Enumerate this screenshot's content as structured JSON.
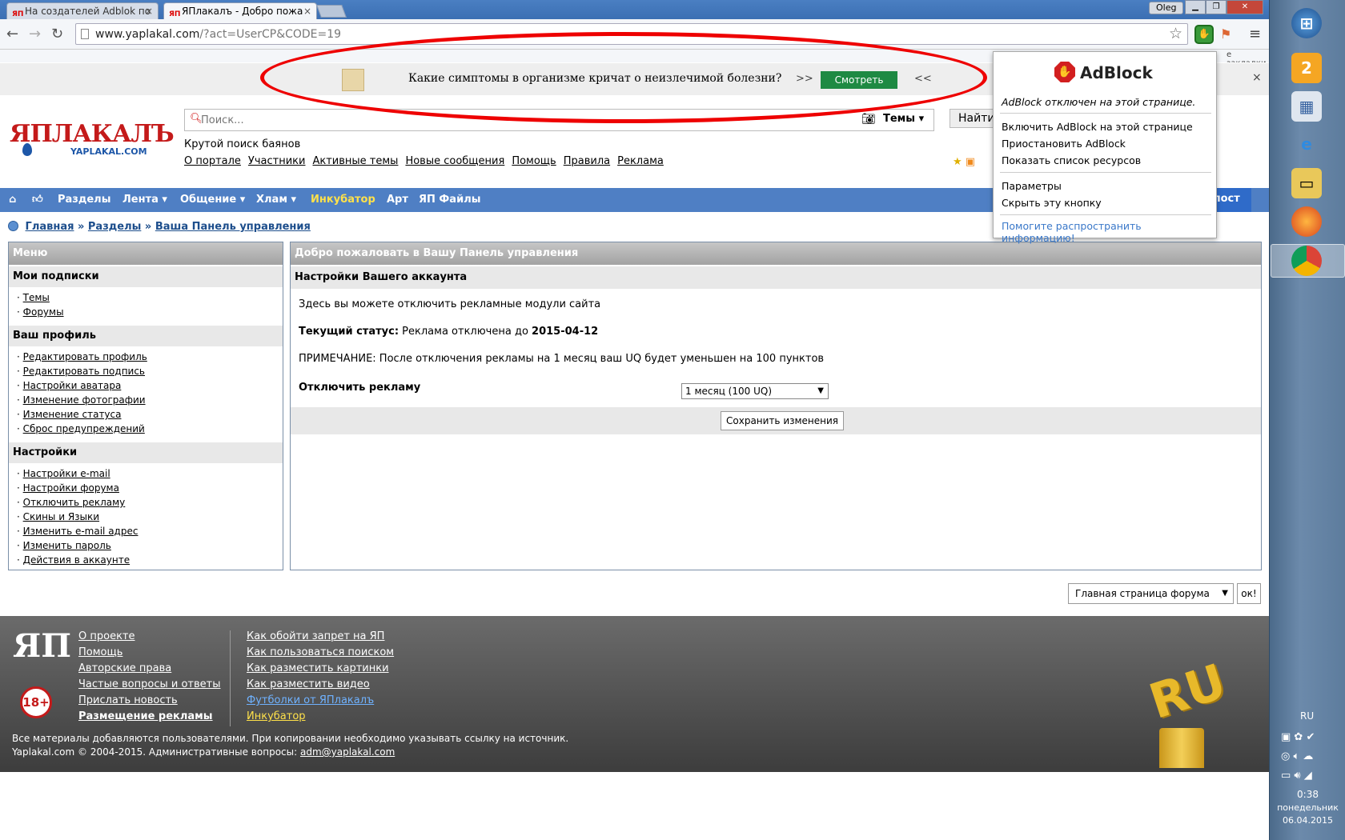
{
  "browser": {
    "tabs": [
      {
        "favicon": "ЯП",
        "title": "На создателей Adblok по"
      },
      {
        "favicon": "ЯП",
        "title": "ЯПлакалъ - Добро пожа"
      }
    ],
    "user": "Oleg",
    "url_host": "www.yaplakal.com",
    "url_path": "/?act=UserCP&CODE=19",
    "bookmarks_right": "е закладки"
  },
  "ad_banner": {
    "text": "Какие симптомы в организме кричат о неизлечимой болезни?",
    "arrow_left": ">>",
    "arrow_right": "<<",
    "watch_label": "Смотреть",
    "close_glyph": "×"
  },
  "header": {
    "logo": "ЯПЛАКАЛЪ",
    "logo_sub": "YAPLAKAL.COM",
    "search_placeholder": "Поиск...",
    "search_scope": "Темы",
    "find_label": "Найти",
    "slogan": "Крутой поиск баянов",
    "top_links": [
      "О портале",
      "Участники",
      "Активные темы",
      "Новые сообщения",
      "Помощь",
      "Правила",
      "Реклама"
    ]
  },
  "nav": {
    "items": [
      "Разделы",
      "Лента",
      "Общение",
      "Хлам",
      "Инкубатор",
      "Арт",
      "ЯП Файлы"
    ],
    "new_post": "й пост"
  },
  "breadcrumb": [
    "Главная",
    "Разделы",
    "Ваша Панель управления"
  ],
  "breadcrumb_sep": "»",
  "menu": {
    "title": "Меню",
    "sections": [
      {
        "title": "Мои подписки",
        "items": [
          "Темы",
          "Форумы"
        ]
      },
      {
        "title": "Ваш профиль",
        "items": [
          "Редактировать профиль",
          "Редактировать подпись",
          "Настройки аватара",
          "Изменение фотографии",
          "Изменение статуса",
          "Сброс предупреждений"
        ]
      },
      {
        "title": "Настройки",
        "items": [
          "Настройки e-mail",
          "Настройки форума",
          "Отключить рекламу",
          "Скины и Языки",
          "Изменить e-mail адрес",
          "Изменить пароль",
          "Действия в аккаунте"
        ]
      }
    ]
  },
  "main": {
    "title": "Добро пожаловать в Вашу Панель управления",
    "subtitle": "Настройки Вашего аккаунта",
    "intro": "Здесь вы можете отключить рекламные модули сайта",
    "status_label": "Текущий статус:",
    "status_text": "Реклама отключена до",
    "status_date": "2015-04-12",
    "note": "ПРИМЕЧАНИЕ: После отключения рекламы на 1 месяц ваш UQ будет уменьшен на 100 пунктов",
    "disable_label": "Отключить рекламу",
    "disable_value": "1 месяц (100 UQ)",
    "save_label": "Сохранить изменения"
  },
  "jump": {
    "value": "Главная страница форума",
    "ok_label": "ок!"
  },
  "footer": {
    "logo": "ЯП",
    "age": "18+",
    "col1": [
      "О проекте",
      "Помощь",
      "Авторские права",
      "Частые вопросы и ответы",
      "Прислать новость",
      "Размещение рекламы"
    ],
    "col2": [
      "Как обойти запрет на ЯП",
      "Как пользоваться поиском",
      "Как разместить картинки",
      "Как разместить видео",
      "Футболки от ЯПлакалъ",
      "Инкубатор"
    ],
    "copy1": "Все материалы добавляются пользователями. При копировании необходимо указывать ссылку на источник.",
    "copy2": "Yaplakal.com © 2004-2015. Административные вопросы:",
    "email": "adm@yaplakal.com",
    "ru_badge": "RU"
  },
  "adblock_popup": {
    "name": "AdBlock",
    "status": "AdBlock отключен на этой странице.",
    "items1": [
      "Включить AdBlock на этой странице",
      "Приостановить AdBlock",
      "Показать список ресурсов"
    ],
    "items2": [
      "Параметры",
      "Скрыть эту кнопку"
    ],
    "help": "Помогите распространить информацию!"
  },
  "taskbar": {
    "language": "RU",
    "time": "0:38",
    "day": "понедельник",
    "date": "06.04.2015",
    "badge": "2"
  },
  "colors": {
    "nav_bg": "#4f7fc4",
    "nav_highlight": "#ffe14a",
    "logo_red": "#c41a1a",
    "watch_green": "#1e8a43",
    "annotation_red": "#ee0000"
  }
}
